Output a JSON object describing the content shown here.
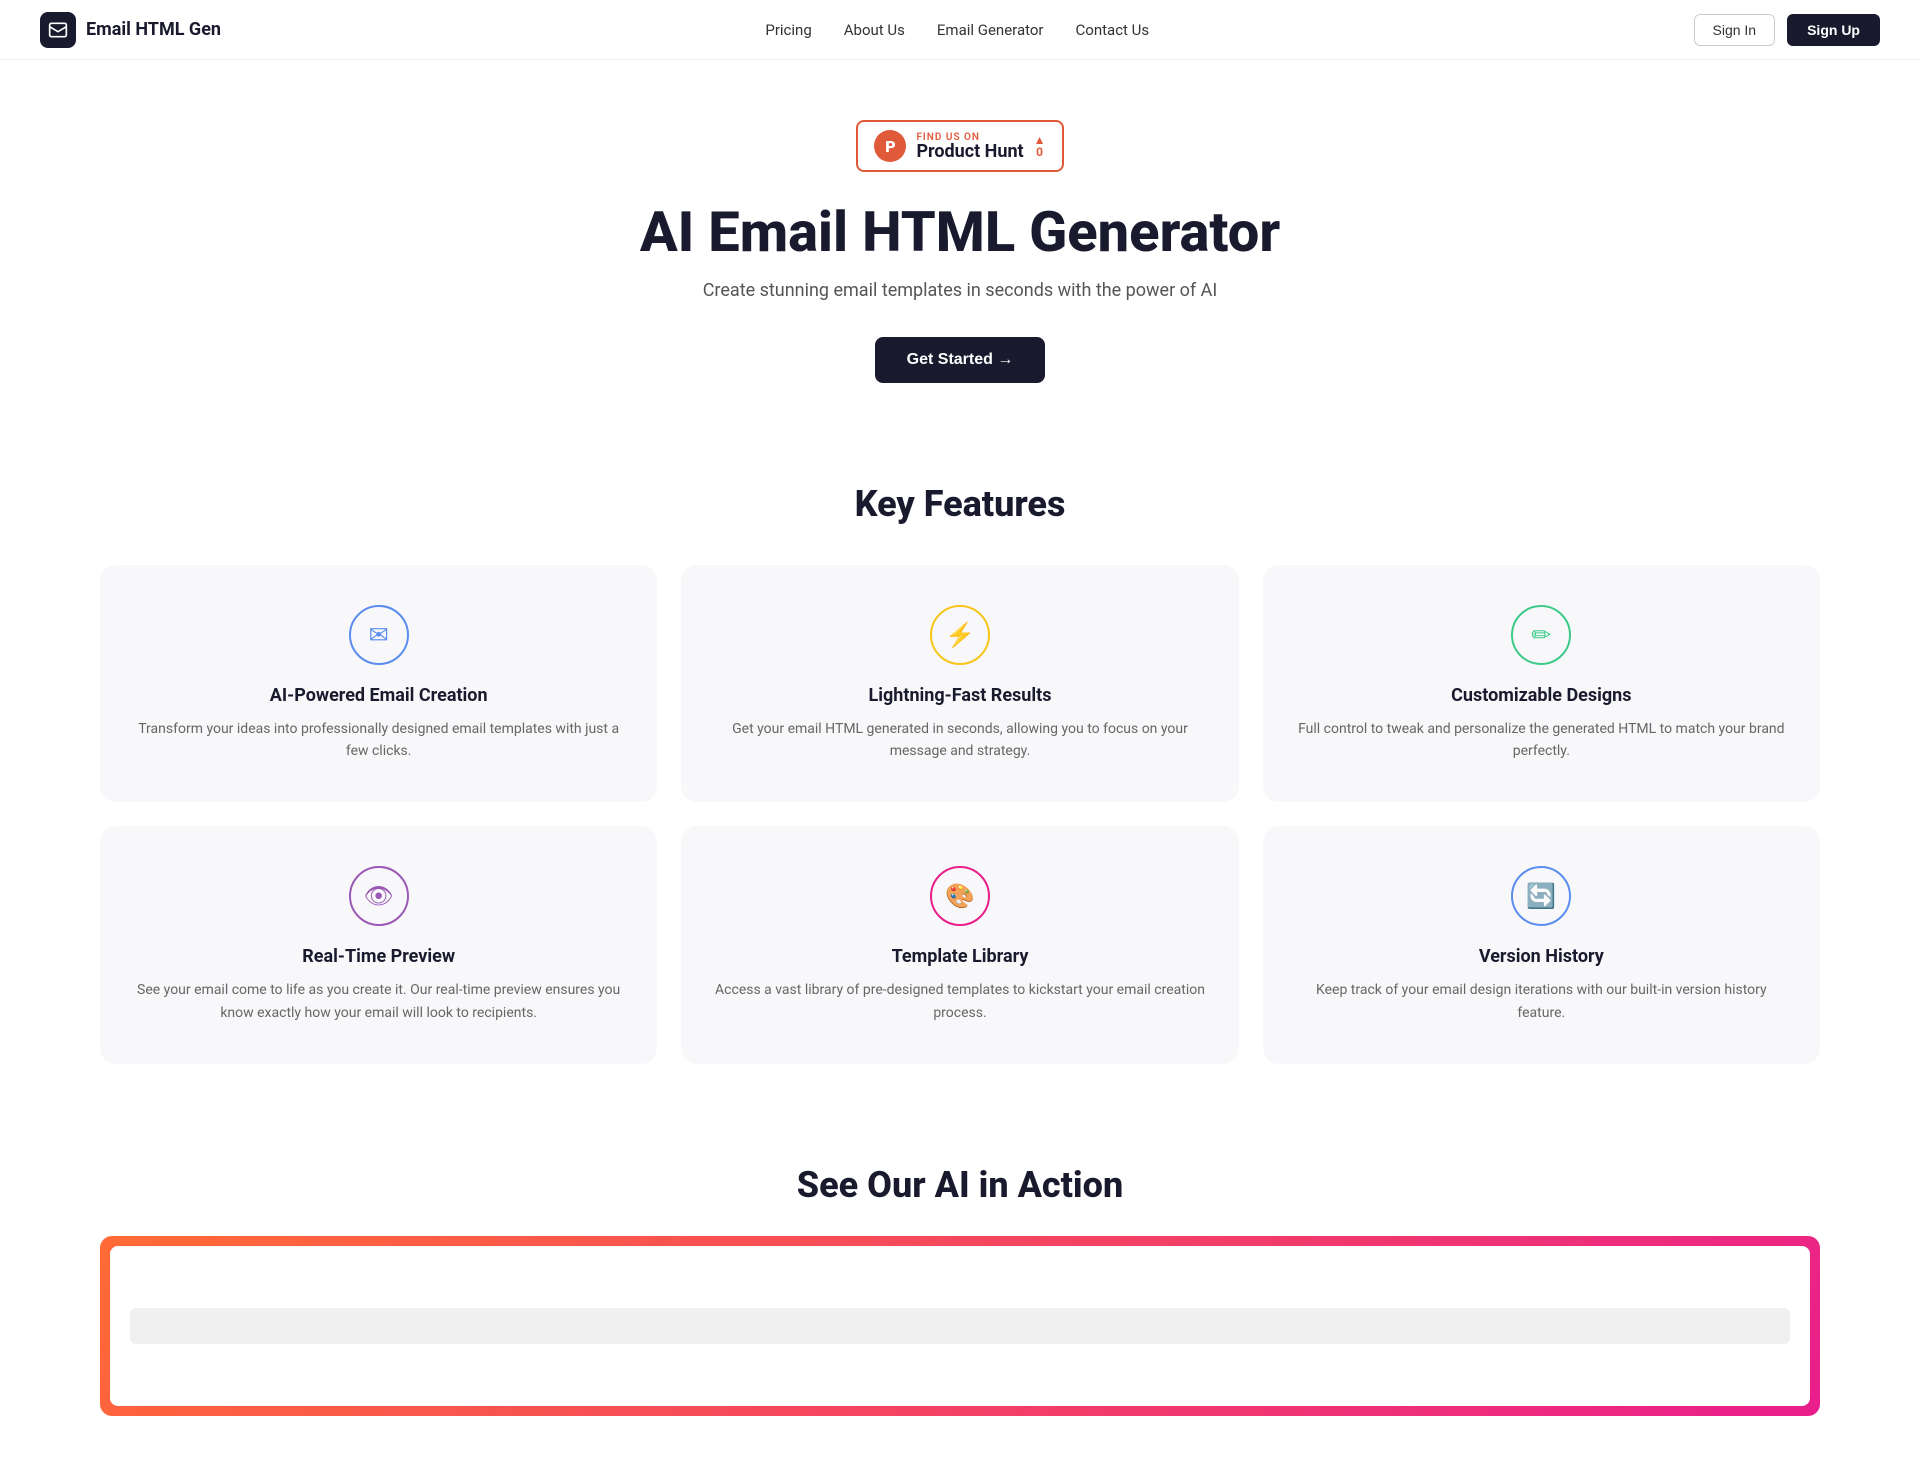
{
  "site": {
    "title": "Email HTML Gen"
  },
  "nav": {
    "logo_text": "Email HTML Gen",
    "links": [
      {
        "label": "Pricing",
        "id": "pricing"
      },
      {
        "label": "About Us",
        "id": "about"
      },
      {
        "label": "Email Generator",
        "id": "generator"
      },
      {
        "label": "Contact Us",
        "id": "contact"
      }
    ],
    "signin_label": "Sign In",
    "signup_label": "Sign Up"
  },
  "hero": {
    "badge": {
      "find_us": "FIND US ON",
      "platform": "Product Hunt",
      "upvote_count": "0"
    },
    "title": "AI Email HTML Generator",
    "subtitle": "Create stunning email templates in seconds with the power of AI",
    "cta_label": "Get Started →"
  },
  "features_section": {
    "title": "Key Features",
    "items": [
      {
        "id": "ai-powered",
        "icon": "✉",
        "icon_class": "icon-blue",
        "title": "AI-Powered Email Creation",
        "desc": "Transform your ideas into professionally designed email templates with just a few clicks."
      },
      {
        "id": "lightning-fast",
        "icon": "⚡",
        "icon_class": "icon-yellow",
        "title": "Lightning-Fast Results",
        "desc": "Get your email HTML generated in seconds, allowing you to focus on your message and strategy."
      },
      {
        "id": "customizable",
        "icon": "✏",
        "icon_class": "icon-green",
        "title": "Customizable Designs",
        "desc": "Full control to tweak and personalize the generated HTML to match your brand perfectly."
      },
      {
        "id": "real-time-preview",
        "icon": "👁",
        "icon_class": "icon-purple",
        "title": "Real-Time Preview",
        "desc": "See your email come to life as you create it. Our real-time preview ensures you know exactly how your email will look to recipients."
      },
      {
        "id": "template-library",
        "icon": "🎨",
        "icon_class": "icon-pink",
        "title": "Template Library",
        "desc": "Access a vast library of pre-designed templates to kickstart your email creation process."
      },
      {
        "id": "version-history",
        "icon": "🔄",
        "icon_class": "icon-teal",
        "title": "Version History",
        "desc": "Keep track of your email design iterations with our built-in version history feature."
      }
    ]
  },
  "demo_section": {
    "title": "See Our AI in Action"
  }
}
